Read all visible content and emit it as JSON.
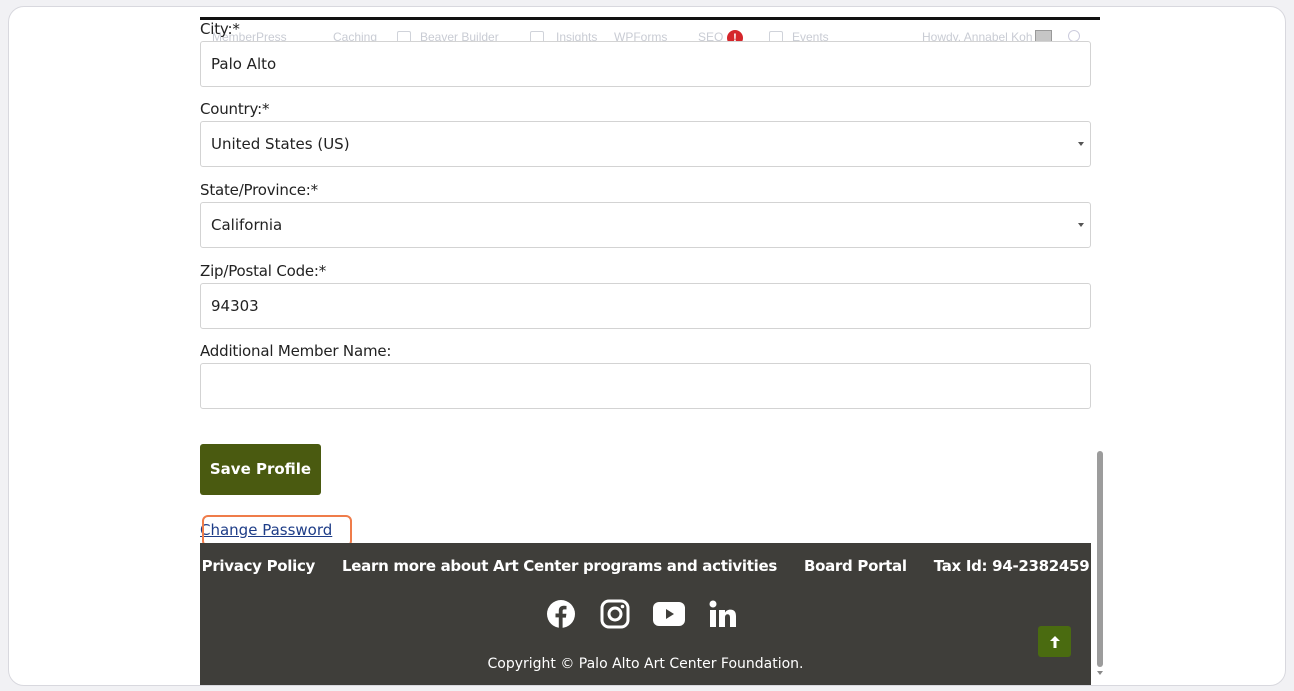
{
  "adminbar": {
    "items": [
      "MemberPress",
      "Caching",
      "Beaver Builder",
      "Insights",
      "WPForms",
      "SEO",
      "Events"
    ],
    "seo_badge": "!",
    "greeting": "Howdy, Annabel Koh"
  },
  "form": {
    "city": {
      "label": "City:*",
      "value": "Palo Alto"
    },
    "country": {
      "label": "Country:*",
      "value": "United States (US)"
    },
    "state": {
      "label": "State/Province:*",
      "value": "California"
    },
    "zip": {
      "label": "Zip/Postal Code:*",
      "value": "94303"
    },
    "additional": {
      "label": "Additional Member Name:",
      "value": ""
    },
    "save_label": "Save Profile",
    "change_password_label": "Change Password"
  },
  "footer": {
    "links": [
      "Privacy Policy",
      "Learn more about Art Center programs and activities",
      "Board Portal",
      "Tax Id: 94-2382459"
    ],
    "socials": [
      "facebook-icon",
      "instagram-icon",
      "youtube-icon",
      "linkedin-icon"
    ],
    "copyright": "Copyright © Palo Alto Art Center Foundation."
  },
  "colors": {
    "save_button": "#4a5a10",
    "footer_bg": "#3f3e3a",
    "link": "#1d3c87",
    "highlight": "#ef7c4a"
  }
}
